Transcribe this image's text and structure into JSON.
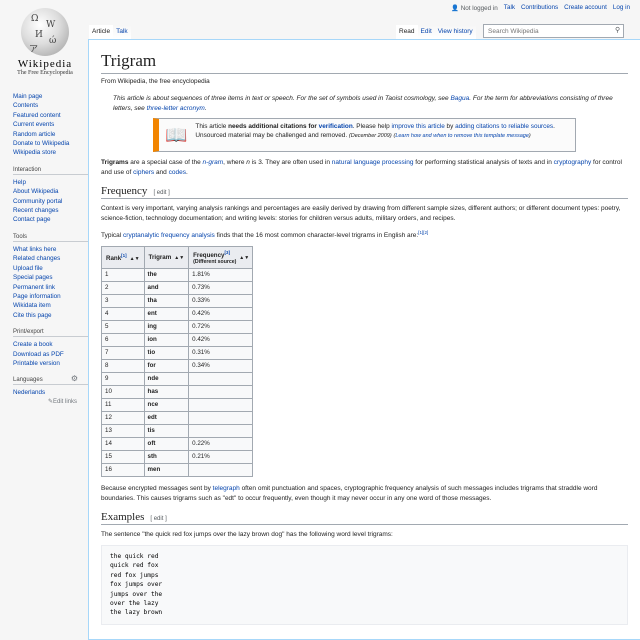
{
  "logo": {
    "wordmark": "Wikipedia",
    "tagline": "The Free Encyclopedia"
  },
  "personal": {
    "not_logged_in": "Not logged in",
    "talk": "Talk",
    "contributions": "Contributions",
    "create_account": "Create account",
    "login": "Log in"
  },
  "tabs": {
    "article": "Article",
    "talk": "Talk",
    "read": "Read",
    "edit": "Edit",
    "history": "View history"
  },
  "search": {
    "placeholder": "Search Wikipedia"
  },
  "sidebar": {
    "nav": [
      "Main page",
      "Contents",
      "Featured content",
      "Current events",
      "Random article",
      "Donate to Wikipedia",
      "Wikipedia store"
    ],
    "interaction_title": "Interaction",
    "interaction": [
      "Help",
      "About Wikipedia",
      "Community portal",
      "Recent changes",
      "Contact page"
    ],
    "tools_title": "Tools",
    "tools": [
      "What links here",
      "Related changes",
      "Upload file",
      "Special pages",
      "Permanent link",
      "Page information",
      "Wikidata item",
      "Cite this page"
    ],
    "print_title": "Print/export",
    "print": [
      "Create a book",
      "Download as PDF",
      "Printable version"
    ],
    "languages_title": "Languages",
    "languages": [
      "Nederlands"
    ],
    "edit_links": "Edit links"
  },
  "article": {
    "title": "Trigram",
    "site_sub": "From Wikipedia, the free encyclopedia",
    "hatnote_a": "This article is about sequences of three items in text or speech. For the set of symbols used in Taoist cosmology, see ",
    "hatnote_link1": "Bagua",
    "hatnote_b": ". For the term for abbreviations consisting of three letters, see ",
    "hatnote_link2": "three-letter acronym",
    "hatnote_c": ".",
    "ambox": {
      "a": "This article ",
      "bold": "needs additional citations for ",
      "link_verification": "verification",
      "b": ". Please help ",
      "link_improve": "improve this article",
      "c": " by ",
      "link_adding": "adding citations to reliable sources",
      "d": ". Unsourced material may be challenged and removed. ",
      "date": "(December 2009)",
      "link_learn": "Learn how and when to remove this template message"
    },
    "intro": {
      "bold": "Trigrams",
      "a": " are a special case of the ",
      "ngram": "n-gram",
      "b": ", where ",
      "n": "n",
      "c": " is 3. They are often used in ",
      "nlp": "natural language processing",
      "d": " for performing statistical analysis of texts and in ",
      "crypto": "cryptography",
      "e": " for control and use of ",
      "ciphers": "ciphers",
      "f": " and ",
      "codes": "codes",
      "g": "."
    },
    "freq_heading": "Frequency",
    "edit_label": "[ edit ]",
    "freq_p1": "Context is very important, varying analysis rankings and percentages are easily derived by drawing from different sample sizes, different authors; or different document types: poetry, science-fiction, technology documentation; and writing levels: stories for children versus adults, military orders, and recipes.",
    "freq_p2_a": "Typical ",
    "freq_p2_link": "cryptanalytic frequency analysis",
    "freq_p2_b": " finds that the 16 most common character-level trigrams in English are:",
    "freq_p2_refs": "[1][2]",
    "table": {
      "headers": {
        "rank": "Rank",
        "rank_ref": "[1]",
        "trigram": "Trigram",
        "freq": "Frequency",
        "freq_ref": "[3]",
        "freq_sub": "(Different source)"
      },
      "rows": [
        [
          "1",
          "the",
          "1.81%"
        ],
        [
          "2",
          "and",
          "0.73%"
        ],
        [
          "3",
          "tha",
          "0.33%"
        ],
        [
          "4",
          "ent",
          "0.42%"
        ],
        [
          "5",
          "ing",
          "0.72%"
        ],
        [
          "6",
          "ion",
          "0.42%"
        ],
        [
          "7",
          "tio",
          "0.31%"
        ],
        [
          "8",
          "for",
          "0.34%"
        ],
        [
          "9",
          "nde",
          ""
        ],
        [
          "10",
          "has",
          ""
        ],
        [
          "11",
          "nce",
          ""
        ],
        [
          "12",
          "edt",
          ""
        ],
        [
          "13",
          "tis",
          ""
        ],
        [
          "14",
          "oft",
          "0.22%"
        ],
        [
          "15",
          "sth",
          "0.21%"
        ],
        [
          "16",
          "men",
          ""
        ]
      ]
    },
    "after_a": "Because encrypted messages sent by ",
    "after_link": "telegraph",
    "after_b": " often omit punctuation and spaces, cryptographic frequency analysis of such messages includes trigrams that straddle word boundaries. This causes trigrams such as \"edt\" to occur frequently, even though it may never occur in any one word of those messages.",
    "examples_heading": "Examples",
    "examples_p": "The sentence \"the quick red fox jumps over the lazy brown dog\" has the following word level trigrams:",
    "code_lines": [
      "the quick red",
      "quick red fox",
      "red fox jumps",
      "fox jumps over",
      "jumps over the",
      "over the lazy",
      "the lazy brown"
    ]
  }
}
